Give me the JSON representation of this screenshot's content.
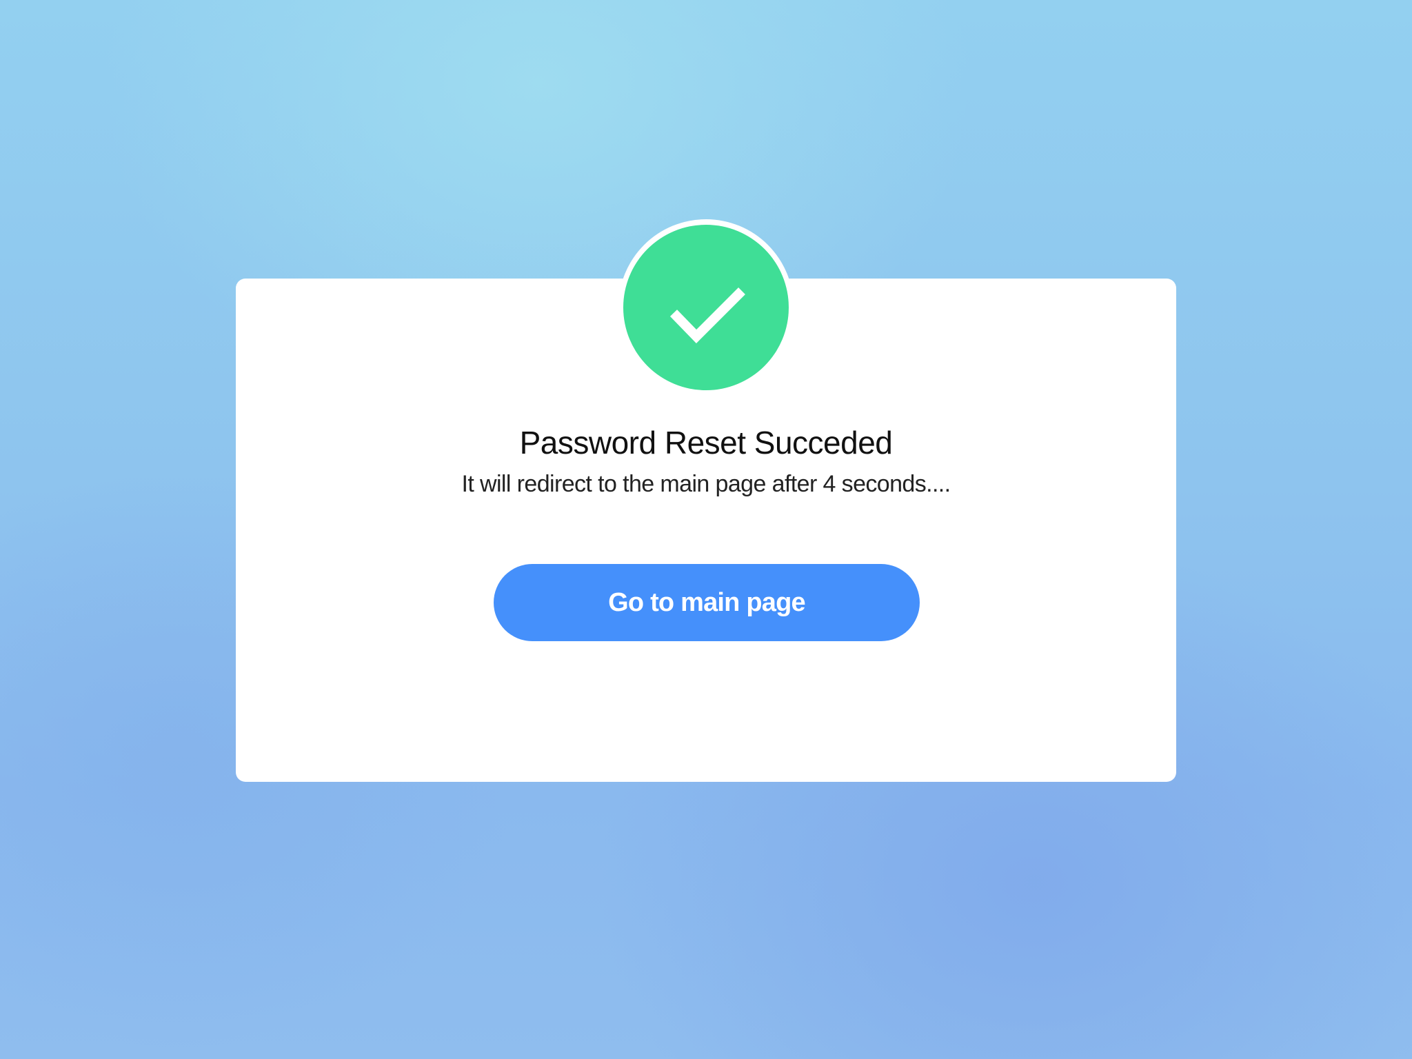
{
  "dialog": {
    "title": "Password Reset Succeded",
    "message": "It will redirect to the main page after 4 seconds....",
    "button_label": "Go to main page",
    "icon": "check-icon"
  },
  "colors": {
    "background_top": "#93d0f0",
    "background_bottom": "#8ab9ee",
    "card": "#ffffff",
    "success_badge": "#3fde96",
    "button": "#4590fb",
    "title_text": "#111111"
  }
}
